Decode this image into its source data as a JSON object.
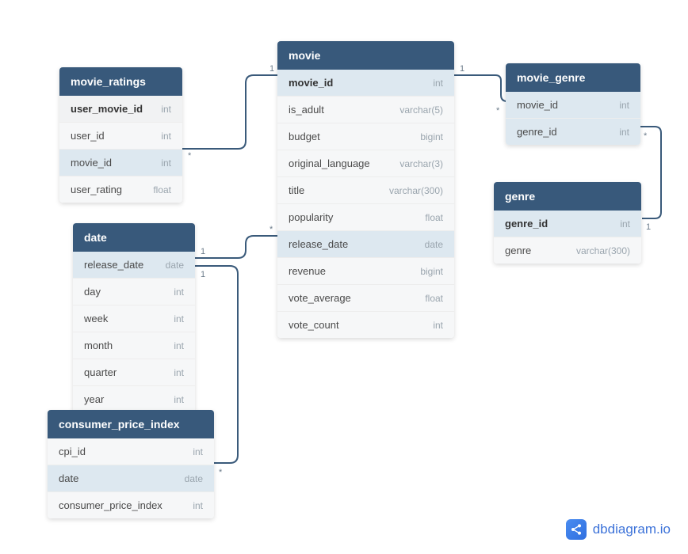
{
  "watermark": "dbdiagram.io",
  "tables": {
    "movie_ratings": {
      "title": "movie_ratings",
      "columns": [
        {
          "name": "user_movie_id",
          "type": "int",
          "pk": true
        },
        {
          "name": "user_id",
          "type": "int"
        },
        {
          "name": "movie_id",
          "type": "int",
          "highlight": true
        },
        {
          "name": "user_rating",
          "type": "float"
        }
      ]
    },
    "movie": {
      "title": "movie",
      "columns": [
        {
          "name": "movie_id",
          "type": "int",
          "pk": true,
          "highlight": true
        },
        {
          "name": "is_adult",
          "type": "varchar(5)"
        },
        {
          "name": "budget",
          "type": "bigint"
        },
        {
          "name": "original_language",
          "type": "varchar(3)"
        },
        {
          "name": "title",
          "type": "varchar(300)"
        },
        {
          "name": "popularity",
          "type": "float"
        },
        {
          "name": "release_date",
          "type": "date",
          "highlight": true
        },
        {
          "name": "revenue",
          "type": "bigint"
        },
        {
          "name": "vote_average",
          "type": "float"
        },
        {
          "name": "vote_count",
          "type": "int"
        }
      ]
    },
    "movie_genre": {
      "title": "movie_genre",
      "columns": [
        {
          "name": "movie_id",
          "type": "int",
          "highlight": true
        },
        {
          "name": "genre_id",
          "type": "int",
          "highlight": true
        }
      ]
    },
    "date": {
      "title": "date",
      "columns": [
        {
          "name": "release_date",
          "type": "date",
          "highlight": true
        },
        {
          "name": "day",
          "type": "int"
        },
        {
          "name": "week",
          "type": "int"
        },
        {
          "name": "month",
          "type": "int"
        },
        {
          "name": "quarter",
          "type": "int"
        },
        {
          "name": "year",
          "type": "int"
        }
      ]
    },
    "genre": {
      "title": "genre",
      "columns": [
        {
          "name": "genre_id",
          "type": "int",
          "pk": true,
          "highlight": true
        },
        {
          "name": "genre",
          "type": "varchar(300)"
        }
      ]
    },
    "consumer_price_index": {
      "title": "consumer_price_index",
      "columns": [
        {
          "name": "cpi_id",
          "type": "int"
        },
        {
          "name": "date",
          "type": "date",
          "highlight": true
        },
        {
          "name": "consumer_price_index",
          "type": "int"
        }
      ]
    }
  },
  "relationships": [
    {
      "from": "movie_ratings.movie_id",
      "to": "movie.movie_id",
      "from_card": "*",
      "to_card": "1"
    },
    {
      "from": "movie.movie_id",
      "to": "movie_genre.movie_id",
      "from_card": "1",
      "to_card": "*"
    },
    {
      "from": "movie_genre.genre_id",
      "to": "genre.genre_id",
      "from_card": "*",
      "to_card": "1"
    },
    {
      "from": "date.release_date",
      "to": "movie.release_date",
      "from_card": "1",
      "to_card": "*"
    },
    {
      "from": "consumer_price_index.date",
      "to": "date.release_date",
      "from_card": "*",
      "to_card": "1"
    }
  ]
}
